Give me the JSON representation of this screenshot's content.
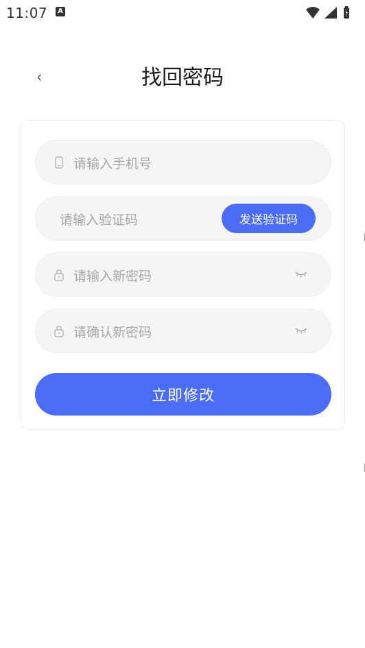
{
  "status_bar": {
    "time": "11:07",
    "notification_icon_letter": "A",
    "icons": [
      "wifi-icon",
      "signal-icon",
      "battery-icon"
    ]
  },
  "header": {
    "back_icon": "chevron-left-icon",
    "title": "找回密码"
  },
  "form": {
    "phone": {
      "placeholder": "请输入手机号",
      "icon": "phone-icon"
    },
    "code": {
      "placeholder": "请输入验证码",
      "send_label": "发送验证码"
    },
    "new_password": {
      "placeholder": "请输入新密码",
      "icon": "lock-icon",
      "toggle_icon": "eye-closed-icon"
    },
    "confirm_password": {
      "placeholder": "请确认新密码",
      "icon": "lock-icon",
      "toggle_icon": "eye-closed-icon"
    },
    "submit_label": "立即修改"
  },
  "colors": {
    "accent": "#4b6cf5",
    "field_bg": "#f5f5f5",
    "placeholder": "#a7a7a7",
    "title": "#1a1a1a"
  }
}
